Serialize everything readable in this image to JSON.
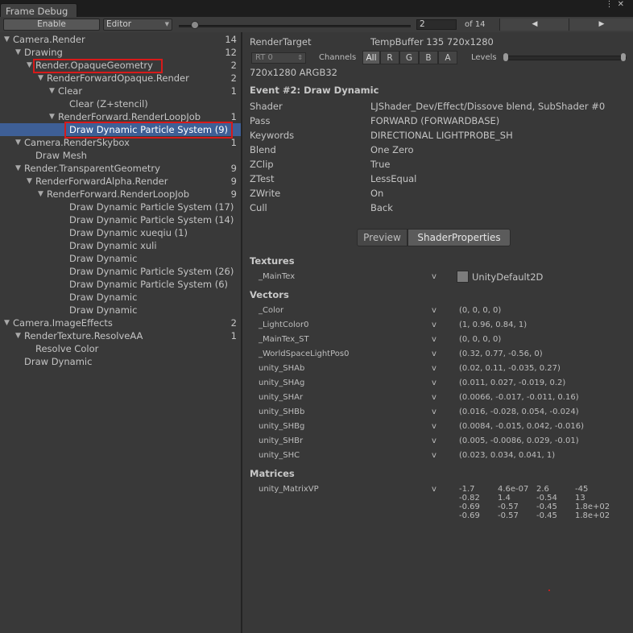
{
  "window": {
    "tab_title": "Frame Debug",
    "menu_glyph": "⋮ ✕"
  },
  "toolbar": {
    "enable_label": "Enable",
    "target_label": "Editor",
    "event_index": "2",
    "event_total": "of 14",
    "prev_glyph": "◀",
    "next_glyph": "▶",
    "slider_fraction": 0.071
  },
  "tree": [
    {
      "label": "Camera.Render",
      "count": "14",
      "expanded": true
    },
    {
      "label": "Drawing",
      "count": "12",
      "expanded": true
    },
    {
      "label": "Render.OpaqueGeometry",
      "count": "2",
      "expanded": true
    },
    {
      "label": "RenderForwardOpaque.Render",
      "count": "2",
      "expanded": true
    },
    {
      "label": "Clear",
      "count": "1",
      "expanded": true
    },
    {
      "label": "Clear (Z+stencil)",
      "count": ""
    },
    {
      "label": "RenderForward.RenderLoopJob",
      "count": "1",
      "expanded": true
    },
    {
      "label": "Draw Dynamic Particle System (9)",
      "count": "",
      "selected": true
    },
    {
      "label": "Camera.RenderSkybox",
      "count": "1",
      "expanded": true
    },
    {
      "label": "Draw Mesh",
      "count": ""
    },
    {
      "label": "Render.TransparentGeometry",
      "count": "9",
      "expanded": true
    },
    {
      "label": "RenderForwardAlpha.Render",
      "count": "9",
      "expanded": true
    },
    {
      "label": "RenderForward.RenderLoopJob",
      "count": "9",
      "expanded": true
    },
    {
      "label": "Draw Dynamic Particle System (17)",
      "count": ""
    },
    {
      "label": "Draw Dynamic Particle System (14)",
      "count": ""
    },
    {
      "label": "Draw Dynamic xueqiu (1)",
      "count": ""
    },
    {
      "label": "Draw Dynamic xuli",
      "count": ""
    },
    {
      "label": "Draw Dynamic",
      "count": ""
    },
    {
      "label": "Draw Dynamic Particle System (26)",
      "count": ""
    },
    {
      "label": "Draw Dynamic Particle System (6)",
      "count": ""
    },
    {
      "label": "Draw Dynamic",
      "count": ""
    },
    {
      "label": "Draw Dynamic",
      "count": ""
    },
    {
      "label": "Camera.ImageEffects",
      "count": "2",
      "expanded": true
    },
    {
      "label": "RenderTexture.ResolveAA",
      "count": "1",
      "expanded": true
    },
    {
      "label": "Resolve Color",
      "count": ""
    },
    {
      "label": "Draw Dynamic",
      "count": ""
    }
  ],
  "detail": {
    "render_target_key": "RenderTarget",
    "render_target_value": "TempBuffer 135 720x1280",
    "rt_dropdown": "RT 0",
    "channels_label": "Channels",
    "channel_buttons": [
      "All",
      "R",
      "G",
      "B",
      "A"
    ],
    "levels_label": "Levels",
    "format": "720x1280 ARGB32",
    "event_title": "Event #2: Draw Dynamic",
    "props": [
      {
        "key": "Shader",
        "value": "LJShader_Dev/Effect/Dissove blend, SubShader #0"
      },
      {
        "key": "Pass",
        "value": "FORWARD (FORWARDBASE)"
      },
      {
        "key": "Keywords",
        "value": "DIRECTIONAL LIGHTPROBE_SH"
      },
      {
        "key": "Blend",
        "value": "One Zero"
      },
      {
        "key": "ZClip",
        "value": "True"
      },
      {
        "key": "ZTest",
        "value": "LessEqual"
      },
      {
        "key": "ZWrite",
        "value": "On"
      },
      {
        "key": "Cull",
        "value": "Back"
      }
    ],
    "tab_preview": "Preview",
    "tab_shader_properties": "ShaderProperties",
    "textures_header": "Textures",
    "textures": [
      {
        "name": "_MainTex",
        "stage": "v",
        "value": "UnityDefault2D"
      }
    ],
    "vectors_header": "Vectors",
    "vectors": [
      {
        "name": "_Color",
        "stage": "v",
        "value": "(0, 0, 0, 0)"
      },
      {
        "name": "_LightColor0",
        "stage": "v",
        "value": "(1, 0.96, 0.84, 1)"
      },
      {
        "name": "_MainTex_ST",
        "stage": "v",
        "value": "(0, 0, 0, 0)"
      },
      {
        "name": "_WorldSpaceLightPos0",
        "stage": "v",
        "value": "(0.32, 0.77, -0.56, 0)"
      },
      {
        "name": "unity_SHAb",
        "stage": "v",
        "value": "(0.02, 0.11, -0.035, 0.27)"
      },
      {
        "name": "unity_SHAg",
        "stage": "v",
        "value": "(0.011, 0.027, -0.019, 0.2)"
      },
      {
        "name": "unity_SHAr",
        "stage": "v",
        "value": "(0.0066, -0.017, -0.011, 0.16)"
      },
      {
        "name": "unity_SHBb",
        "stage": "v",
        "value": "(0.016, -0.028, 0.054, -0.024)"
      },
      {
        "name": "unity_SHBg",
        "stage": "v",
        "value": "(0.0084, -0.015, 0.042, -0.016)"
      },
      {
        "name": "unity_SHBr",
        "stage": "v",
        "value": "(0.005, -0.0086, 0.029, -0.01)"
      },
      {
        "name": "unity_SHC",
        "stage": "v",
        "value": "(0.023, 0.034, 0.041, 1)"
      }
    ],
    "matrices_header": "Matrices",
    "matrix": {
      "name": "unity_MatrixVP",
      "stage": "v",
      "rows": [
        [
          "-1.7",
          "4.6e-07",
          "2.6",
          "-45"
        ],
        [
          "-0.82",
          "1.4",
          "-0.54",
          "13"
        ],
        [
          "-0.69",
          "-0.57",
          "-0.45",
          "1.8e+02"
        ],
        [
          "-0.69",
          "-0.57",
          "-0.45",
          "1.8e+02"
        ]
      ]
    }
  },
  "colors": {
    "selection": "#3e5f96",
    "highlight_box": "#d71a1a",
    "panel_bg": "#383838"
  }
}
